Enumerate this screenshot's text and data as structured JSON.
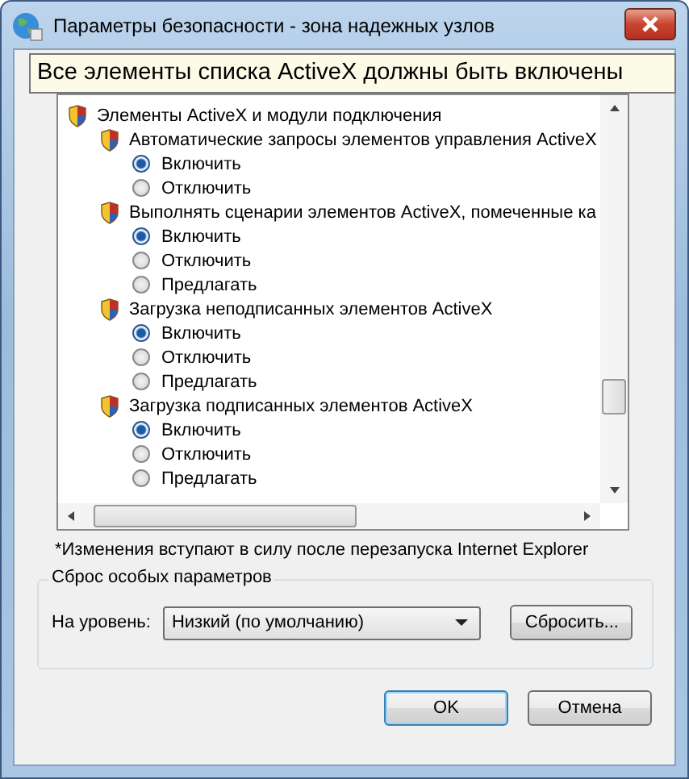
{
  "window": {
    "title": "Параметры безопасности - зона надежных узлов"
  },
  "tooltip": "Все элементы списка ActiveX должны быть включены",
  "tree": {
    "label": "Элементы ActiveX и модули подключения",
    "children": [
      {
        "label": "Автоматические запросы элементов управления ActiveX",
        "options": [
          {
            "label": "Включить",
            "selected": true
          },
          {
            "label": "Отключить",
            "selected": false
          }
        ]
      },
      {
        "label": "Выполнять сценарии элементов ActiveX, помеченные ка",
        "options": [
          {
            "label": "Включить",
            "selected": true
          },
          {
            "label": "Отключить",
            "selected": false
          },
          {
            "label": "Предлагать",
            "selected": false
          }
        ]
      },
      {
        "label": "Загрузка неподписанных элементов ActiveX",
        "options": [
          {
            "label": "Включить",
            "selected": true
          },
          {
            "label": "Отключить",
            "selected": false
          },
          {
            "label": "Предлагать",
            "selected": false
          }
        ]
      },
      {
        "label": "Загрузка подписанных элементов ActiveX",
        "options": [
          {
            "label": "Включить",
            "selected": true
          },
          {
            "label": "Отключить",
            "selected": false
          },
          {
            "label": "Предлагать",
            "selected": false
          }
        ]
      }
    ]
  },
  "note": "*Изменения вступают в силу после перезапуска Internet Explorer",
  "reset": {
    "title": "Сброс особых параметров",
    "level_label": "На уровень:",
    "level_value": "Низкий (по умолчанию)",
    "reset_button": "Сбросить..."
  },
  "buttons": [
    {
      "label": "OK",
      "kind": "default"
    },
    {
      "label": "Отмена",
      "kind": "normal"
    }
  ]
}
